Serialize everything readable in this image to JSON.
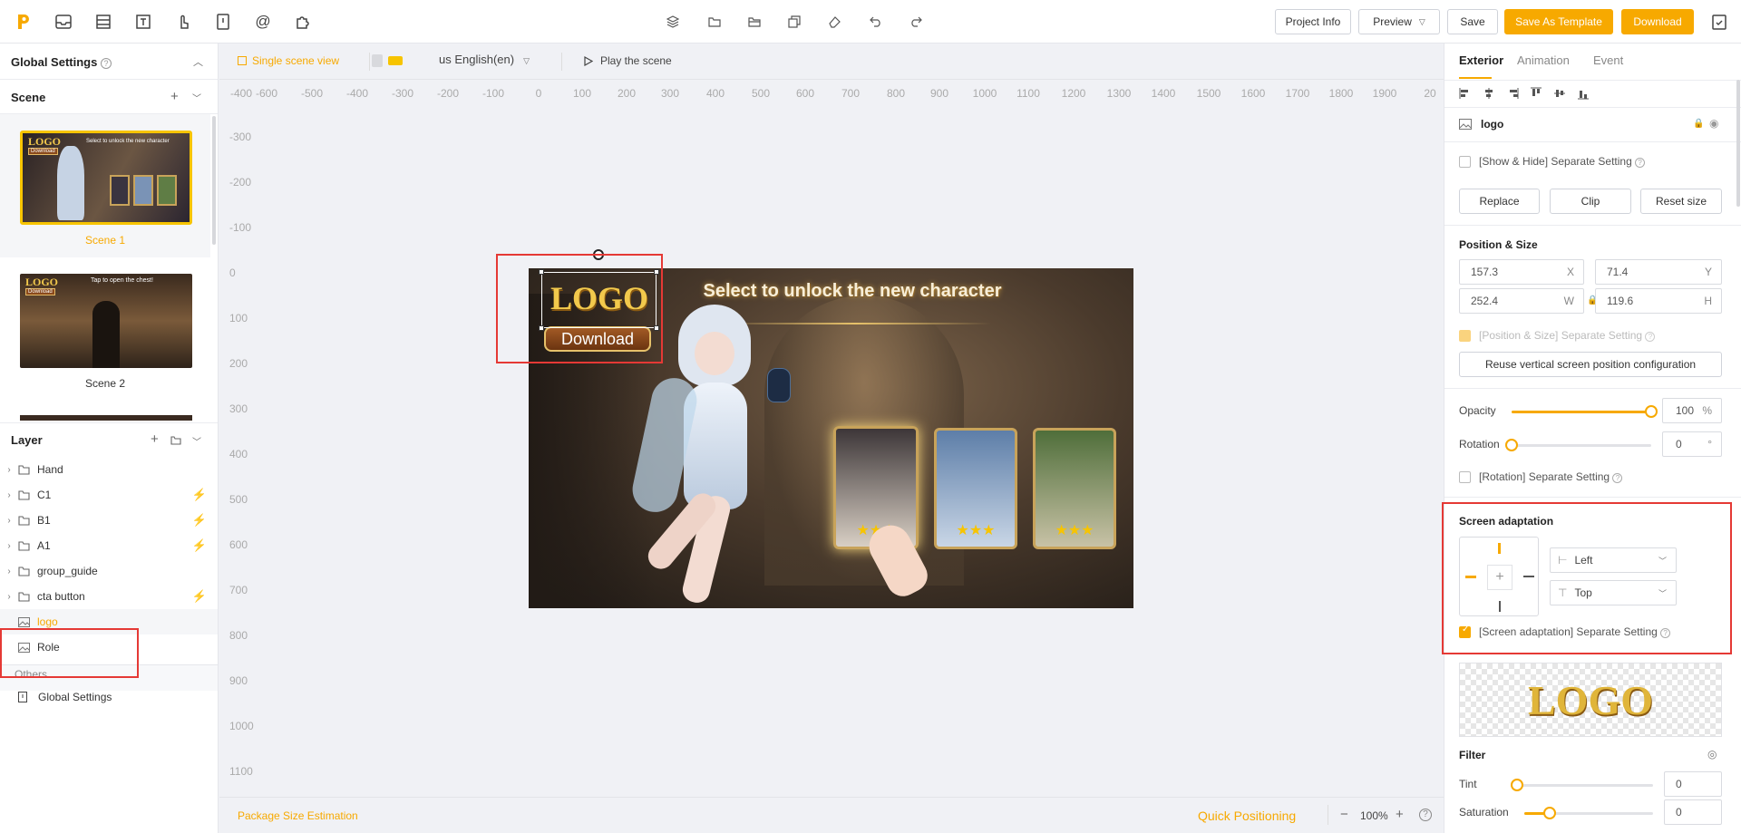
{
  "toolbar": {
    "project_info": "Project Info",
    "preview": "Preview",
    "save": "Save",
    "save_template": "Save As Template",
    "download": "Download",
    "icons": [
      "app-logo",
      "inbox-icon",
      "layout-icon",
      "text-icon",
      "hand-icon",
      "file-icon",
      "at-icon",
      "plugin-icon"
    ]
  },
  "left": {
    "global_settings": "Global Settings",
    "scene_header": "Scene",
    "scenes": [
      {
        "name": "Scene 1",
        "caption": "Select to unlock the new character",
        "logo": "LOGO",
        "badge": "Download"
      },
      {
        "name": "Scene 2",
        "caption": "Tap to open the chest!",
        "logo": "LOGO",
        "badge": "Download"
      }
    ],
    "layer_header": "Layer",
    "layers": [
      {
        "name": "Hand",
        "bolt": false
      },
      {
        "name": "C1",
        "bolt": true
      },
      {
        "name": "B1",
        "bolt": true
      },
      {
        "name": "A1",
        "bolt": true
      },
      {
        "name": "group_guide",
        "bolt": false
      },
      {
        "name": "cta button",
        "bolt": true
      },
      {
        "name": "logo",
        "bolt": false
      },
      {
        "name": "Role",
        "bolt": false
      }
    ],
    "others": "Others",
    "others_item": "Global Settings"
  },
  "canvas": {
    "single_scene": "Single scene view",
    "language": "us English(en)",
    "play": "Play the scene",
    "ruler_x": [
      "-400",
      "-600",
      "-500",
      "-400",
      "-300",
      "-200",
      "-100",
      "0",
      "100",
      "200",
      "300",
      "400",
      "500",
      "600",
      "700",
      "800",
      "900",
      "1000",
      "1100",
      "1200",
      "1300",
      "1400",
      "1500",
      "1600",
      "1700",
      "1800",
      "1900",
      "20"
    ],
    "ruler_y": [
      "-300",
      "-200",
      "-100",
      "0",
      "100",
      "200",
      "300",
      "400",
      "500",
      "600",
      "700",
      "800",
      "900",
      "1000",
      "1100"
    ],
    "scene_title": "Select to unlock the new character",
    "logo_text": "LOGO",
    "download_text": "Download",
    "stars": "★★★",
    "package_estimation": "Package Size Estimation",
    "quick_positioning": "Quick Positioning",
    "zoom": "100%"
  },
  "right": {
    "tabs": [
      "Exterior",
      "Animation",
      "Event"
    ],
    "element_name": "logo",
    "show_hide": "[Show & Hide]  Separate Setting",
    "replace": "Replace",
    "clip": "Clip",
    "reset_size": "Reset size",
    "position_size": "Position & Size",
    "x": "157.3",
    "y": "71.4",
    "w": "252.4",
    "h": "119.6",
    "x_label": "X",
    "y_label": "Y",
    "w_label": "W",
    "h_label": "H",
    "pos_separate": "[Position & Size] Separate Setting",
    "reuse": "Reuse vertical screen position configuration",
    "opacity_label": "Opacity",
    "opacity_value": "100",
    "opacity_unit": "%",
    "opacity_fraction": 1.0,
    "rotation_label": "Rotation",
    "rotation_value": "0",
    "rotation_unit": "°",
    "rotation_fraction": 0.0,
    "rotation_separate": "[Rotation] Separate Setting",
    "screen_adaptation": "Screen adaptation",
    "h_align": "Left",
    "v_align": "Top",
    "screen_separate": "[Screen adaptation] Separate Setting",
    "preview_logo": "LOGO",
    "filter": "Filter",
    "tint_label": "Tint",
    "tint_value": "0",
    "tint_fraction": 0.0,
    "saturation_label": "Saturation",
    "saturation_value": "0",
    "saturation_fraction": 0.2
  },
  "colors": {
    "accent": "#f7a900",
    "highlight_red": "#e53935"
  }
}
